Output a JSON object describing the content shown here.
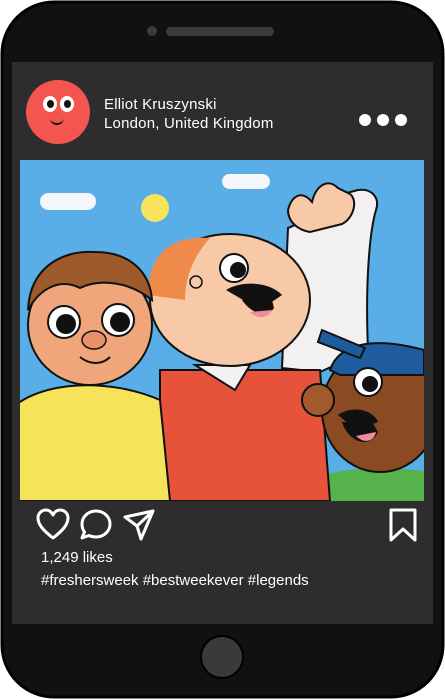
{
  "post": {
    "user": {
      "name": "Elliot Kruszynski",
      "location": "London, United Kingdom"
    },
    "likes": "1,249 likes",
    "caption": "#freshersweek #bestweekever #legends"
  },
  "icons": {
    "avatar": "smiley-face-avatar",
    "more": "more-dots-icon",
    "like": "heart-icon",
    "comment": "comment-bubble-icon",
    "share": "paper-plane-icon",
    "save": "bookmark-icon"
  },
  "colors": {
    "phone_body": "#111111",
    "screen": "#2d2d2d",
    "avatar": "#f4554f",
    "sky": "#5aaee8",
    "text": "#ffffff"
  }
}
